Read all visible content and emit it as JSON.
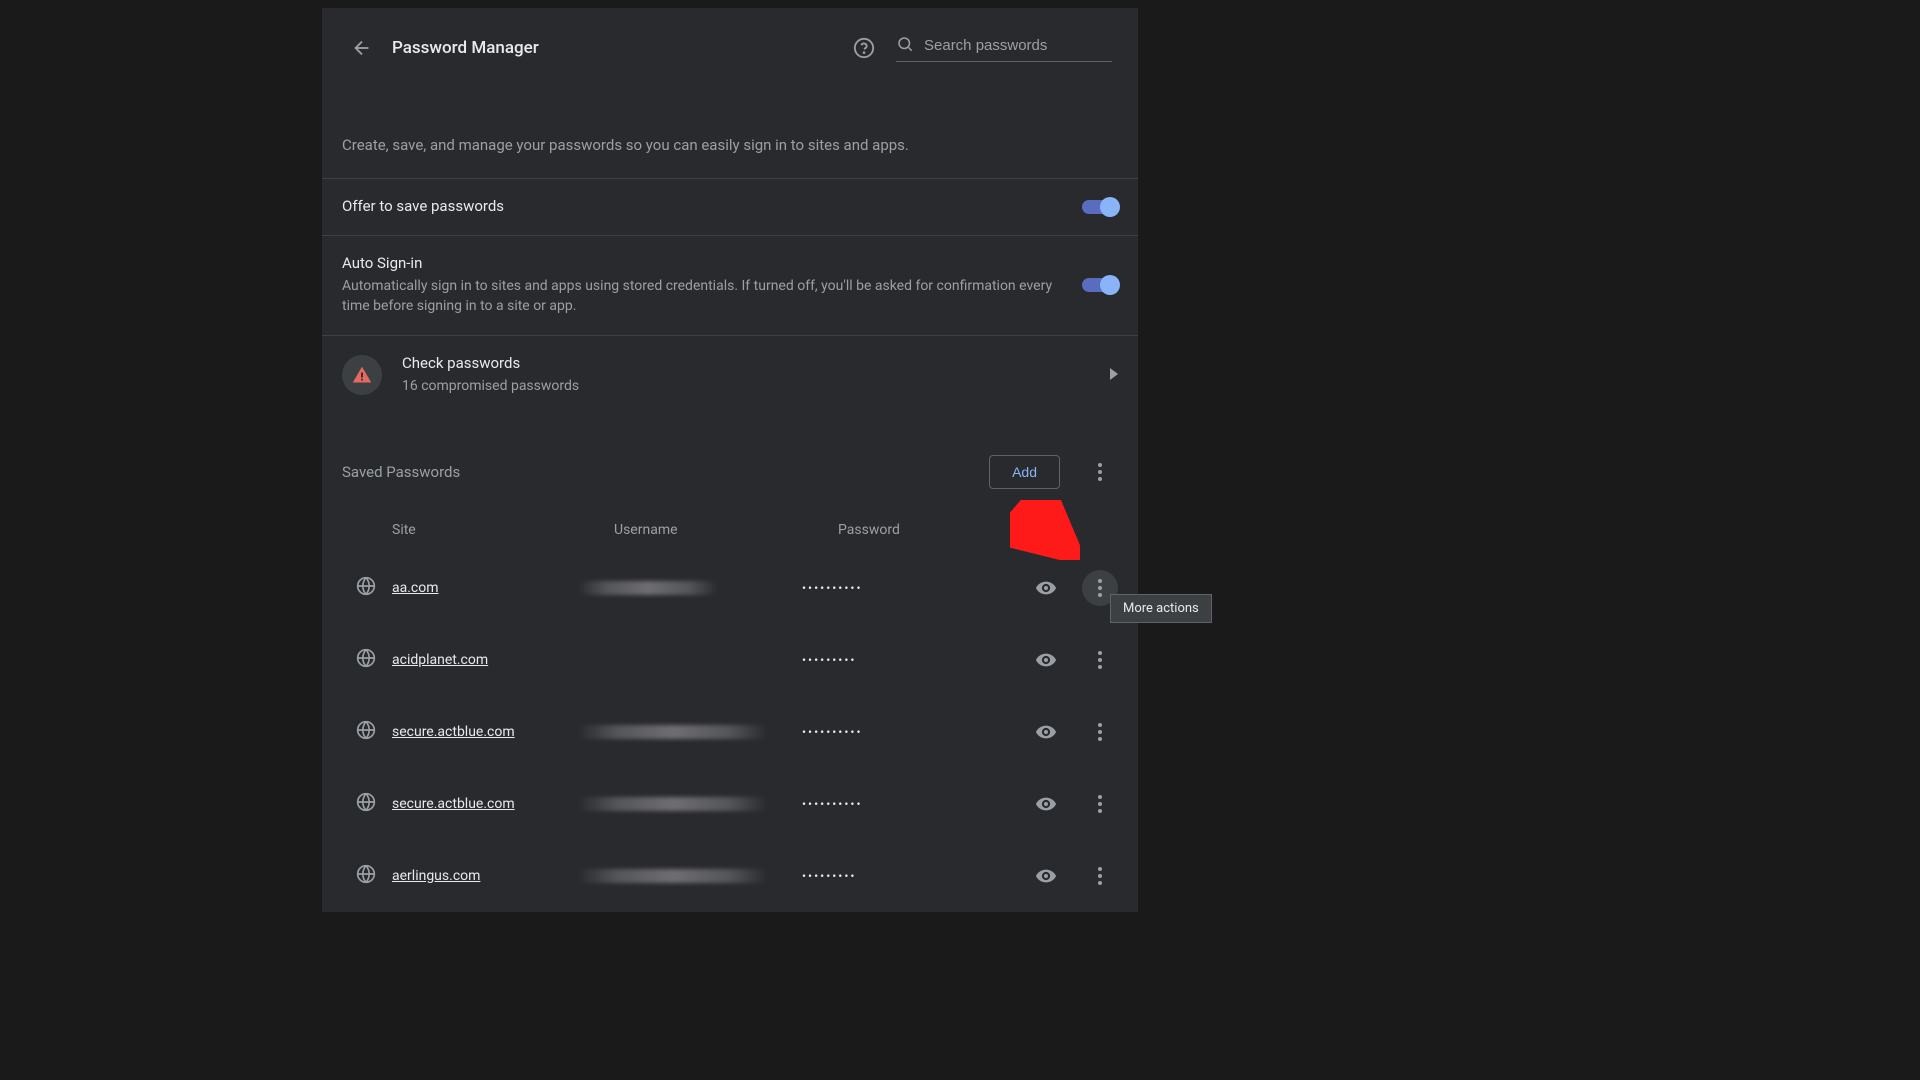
{
  "header": {
    "title": "Password Manager",
    "search_placeholder": "Search passwords"
  },
  "description": "Create, save, and manage your passwords so you can easily sign in to sites and apps.",
  "toggles": {
    "offer_save": {
      "label": "Offer to save passwords"
    },
    "auto_signin": {
      "label": "Auto Sign-in",
      "sub": "Automatically sign in to sites and apps using stored credentials. If turned off, you'll be asked for confirmation every time before signing in to a site or app."
    }
  },
  "check": {
    "title": "Check passwords",
    "sub": "16 compromised passwords"
  },
  "saved": {
    "section_label": "Saved Passwords",
    "add_label": "Add",
    "columns": {
      "site": "Site",
      "user": "Username",
      "pass": "Password"
    },
    "rows": [
      {
        "site": "aa.com",
        "user_blur": true,
        "user_wide": false,
        "dots": "••••••••••"
      },
      {
        "site": "acidplanet.com",
        "user_blur": false,
        "user_wide": false,
        "dots": "•••••••••"
      },
      {
        "site": "secure.actblue.com",
        "user_blur": true,
        "user_wide": true,
        "dots": "••••••••••"
      },
      {
        "site": "secure.actblue.com",
        "user_blur": true,
        "user_wide": true,
        "dots": "••••••••••"
      },
      {
        "site": "aerlingus.com",
        "user_blur": true,
        "user_wide": true,
        "dots": "•••••••••"
      }
    ]
  },
  "tooltip": "More actions"
}
